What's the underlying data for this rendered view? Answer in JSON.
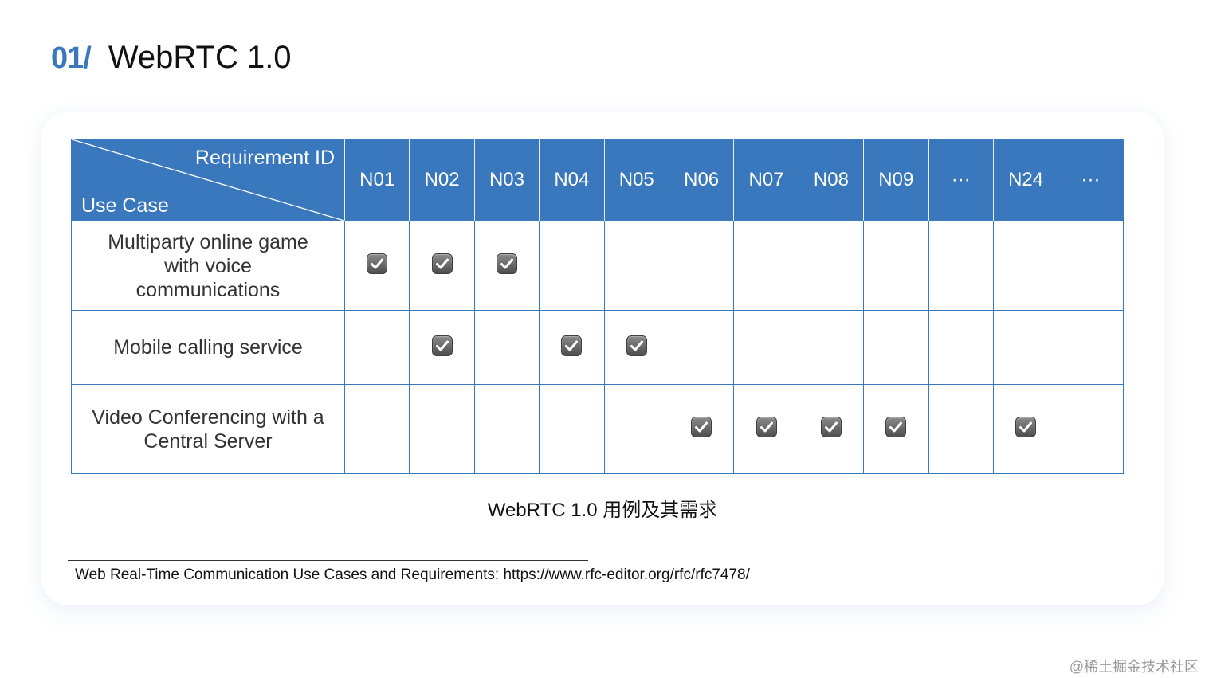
{
  "header": {
    "section_number": "01/",
    "title": "WebRTC 1.0"
  },
  "table": {
    "corner": {
      "column_axis_label": "Requirement ID",
      "row_axis_label": "Use Case"
    },
    "columns": [
      "N01",
      "N02",
      "N03",
      "N04",
      "N05",
      "N06",
      "N07",
      "N08",
      "N09",
      "···",
      "N24",
      "···"
    ],
    "rows": [
      {
        "use_case": "Multiparty online game with voice communications",
        "use_case_lines": [
          "Multiparty online game",
          "with voice",
          "communications"
        ],
        "checked": [
          true,
          true,
          true,
          false,
          false,
          false,
          false,
          false,
          false,
          false,
          false,
          false
        ]
      },
      {
        "use_case": "Mobile calling service",
        "use_case_lines": [
          "Mobile calling service"
        ],
        "checked": [
          false,
          true,
          false,
          true,
          true,
          false,
          false,
          false,
          false,
          false,
          false,
          false
        ]
      },
      {
        "use_case": "Video Conferencing with a Central Server",
        "use_case_lines": [
          "Video Conferencing with a",
          "Central Server"
        ],
        "checked": [
          false,
          false,
          false,
          false,
          false,
          true,
          true,
          true,
          true,
          false,
          true,
          false
        ]
      }
    ],
    "check_icon": "checked-checkbox-icon"
  },
  "caption": "WebRTC 1.0 用例及其需求",
  "footnote": "Web Real-Time Communication Use Cases and Requirements: https://www.rfc-editor.org/rfc/rfc7478/",
  "watermark": "@稀土掘金技术社区",
  "colors": {
    "accent": "#3a78bd",
    "header_text": "#ffffff",
    "check_fill": "#5e5e5e"
  }
}
